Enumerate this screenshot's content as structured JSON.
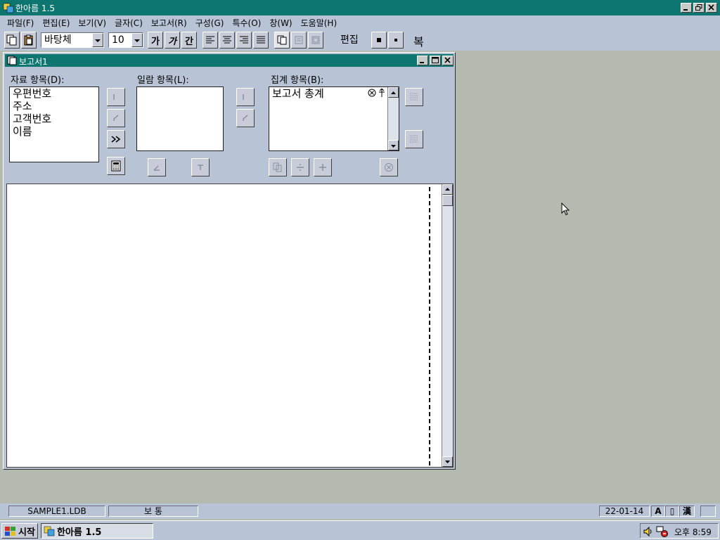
{
  "app": {
    "title": "한아름 1.5"
  },
  "menu": [
    "파일(F)",
    "편집(E)",
    "보기(V)",
    "글자(C)",
    "보고서(R)",
    "구성(G)",
    "특수(O)",
    "창(W)",
    "도움말(H)"
  ],
  "toolbar": {
    "font_name": "바탕체",
    "font_size": "10",
    "bold_glyph": "가",
    "italic_glyph": "가",
    "underline_glyph": "간",
    "mode_label": "편집",
    "trailing_label": "복"
  },
  "report_window": {
    "title": "보고서1",
    "data_items": {
      "label": "자료 항목(D):",
      "items": [
        "우편번호",
        "주소",
        "고객번호",
        "이름"
      ]
    },
    "list_items": {
      "label": "일람 항목(L):",
      "items": []
    },
    "summary_items": {
      "label": "집계 항목(B):",
      "items": [
        "보고서 총계"
      ]
    }
  },
  "status": {
    "file": "SAMPLE1.LDB",
    "mode": "보 통",
    "date": "22-01-14"
  },
  "taskbar": {
    "start_label": "시작",
    "task_label": "한아름 1.5",
    "clock": "오후 8:59"
  }
}
